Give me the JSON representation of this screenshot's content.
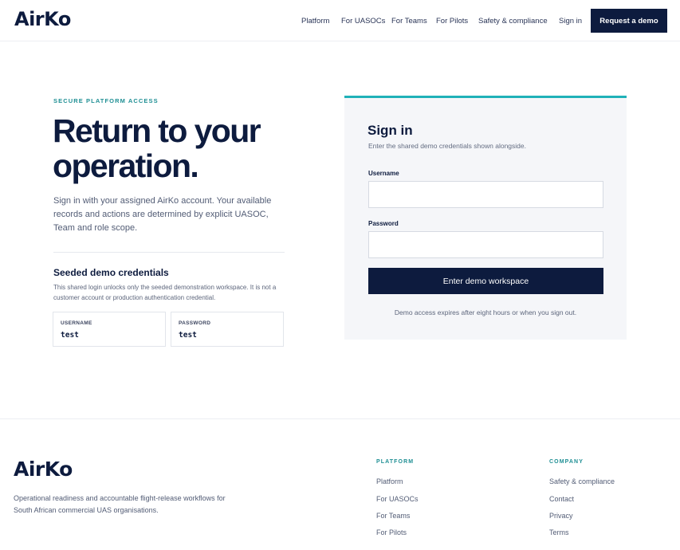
{
  "brand": {
    "logo_text": "AirKo"
  },
  "header": {
    "nav": [
      "Platform",
      "For UASOCs",
      "For Teams",
      "For Pilots",
      "Safety & compliance",
      "Sign in"
    ],
    "cta_label": "Request a demo"
  },
  "hero": {
    "eyebrow": "SECURE PLATFORM ACCESS",
    "title": "Return to your operation.",
    "description": "Sign in with your assigned AirKo account. Your available records and actions are determined by explicit UASOC, Team and role scope."
  },
  "credentials": {
    "title": "Seeded demo credentials",
    "description": "This shared login unlocks only the seeded demonstration workspace. It is not a customer account or production authentication credential.",
    "username_label": "USERNAME",
    "username_value": "test",
    "password_label": "PASSWORD",
    "password_value": "test"
  },
  "signin": {
    "title": "Sign in",
    "subtitle": "Enter the shared demo credentials shown alongside.",
    "username_label": "Username",
    "username_value": "",
    "password_label": "Password",
    "password_value": "",
    "submit_label": "Enter demo workspace",
    "note": "Demo access expires after eight hours or when you sign out."
  },
  "footer": {
    "tagline": "Operational readiness and accountable flight-release workflows for South African commercial UAS organisations.",
    "platform_heading": "PLATFORM",
    "platform_links": [
      "Platform",
      "For UASOCs",
      "For Teams",
      "For Pilots"
    ],
    "company_heading": "COMPANY",
    "company_links": [
      "Safety & compliance",
      "Contact",
      "Privacy",
      "Terms"
    ]
  },
  "colors": {
    "navy": "#0d1b3e",
    "accent_teal": "#20b1b8",
    "eyebrow_teal": "#1f8f94",
    "card_bg": "#f5f6f9"
  }
}
